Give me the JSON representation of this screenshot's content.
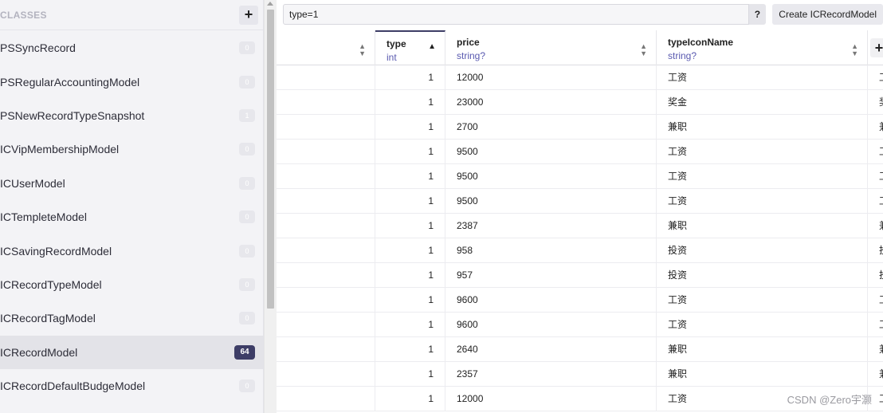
{
  "sidebar": {
    "title": "CLASSES",
    "add_label": "+",
    "items": [
      {
        "label": "PSSyncRecord",
        "count": "0"
      },
      {
        "label": "PSRegularAccountingModel",
        "count": "0"
      },
      {
        "label": "PSNewRecordTypeSnapshot",
        "count": "1"
      },
      {
        "label": "ICVipMembershipModel",
        "count": "0"
      },
      {
        "label": "ICUserModel",
        "count": "0"
      },
      {
        "label": "ICTempleteModel",
        "count": "0"
      },
      {
        "label": "ICSavingRecordModel",
        "count": "0"
      },
      {
        "label": "ICRecordTypeModel",
        "count": "0"
      },
      {
        "label": "ICRecordTagModel",
        "count": "0"
      },
      {
        "label": "ICRecordModel",
        "count": "64",
        "selected": true
      },
      {
        "label": "ICRecordDefaultBudgeModel",
        "count": "0"
      }
    ]
  },
  "query": {
    "value": "type=1",
    "help_label": "?",
    "create_label": "Create ICRecordModel"
  },
  "columns": [
    {
      "name": "",
      "type": ""
    },
    {
      "name": "type",
      "type": "int"
    },
    {
      "name": "price",
      "type": "string?"
    },
    {
      "name": "typeIconName",
      "type": "string?"
    }
  ],
  "add_column_label": "+",
  "rows": [
    {
      "type": "1",
      "price": "12000",
      "icon": "工资",
      "next": "工"
    },
    {
      "type": "1",
      "price": "23000",
      "icon": "奖金",
      "next": "奖"
    },
    {
      "type": "1",
      "price": "2700",
      "icon": "兼职",
      "next": "兼"
    },
    {
      "type": "1",
      "price": "9500",
      "icon": "工资",
      "next": "工"
    },
    {
      "type": "1",
      "price": "9500",
      "icon": "工资",
      "next": "工"
    },
    {
      "type": "1",
      "price": "9500",
      "icon": "工资",
      "next": "工"
    },
    {
      "type": "1",
      "price": "2387",
      "icon": "兼职",
      "next": "兼"
    },
    {
      "type": "1",
      "price": "958",
      "icon": "投资",
      "next": "投"
    },
    {
      "type": "1",
      "price": "957",
      "icon": "投资",
      "next": "投"
    },
    {
      "type": "1",
      "price": "9600",
      "icon": "工资",
      "next": "工"
    },
    {
      "type": "1",
      "price": "9600",
      "icon": "工资",
      "next": "工"
    },
    {
      "type": "1",
      "price": "2640",
      "icon": "兼职",
      "next": "兼"
    },
    {
      "type": "1",
      "price": "2357",
      "icon": "兼职",
      "next": "兼"
    },
    {
      "type": "1",
      "price": "12000",
      "icon": "工资",
      "next": "工"
    }
  ],
  "watermark": "CSDN @Zero宇灏"
}
